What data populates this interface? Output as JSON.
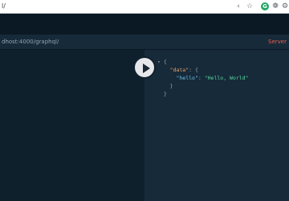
{
  "browser": {
    "url": "l/",
    "icons": [
      "share-icon",
      "star-icon",
      "extension-icon",
      "grammarly-icon",
      "profile-icon"
    ],
    "extension_label": "G"
  },
  "endpoint": {
    "url": "dhost:4000/graphql/",
    "server_label": "Server"
  },
  "result": {
    "open_brace": "{",
    "data_key": "\"data\"",
    "data_colon": ": {",
    "hello_key": "\"hello\"",
    "hello_value": "\"Hello, World\"",
    "inner_close": "}",
    "outer_close": "}",
    "fold_marker": "▾"
  },
  "colors": {
    "background": "#0f202d",
    "panel": "#172a3a",
    "server": "#e85d4a",
    "string": "#55d69a",
    "key": "#e8a365"
  }
}
